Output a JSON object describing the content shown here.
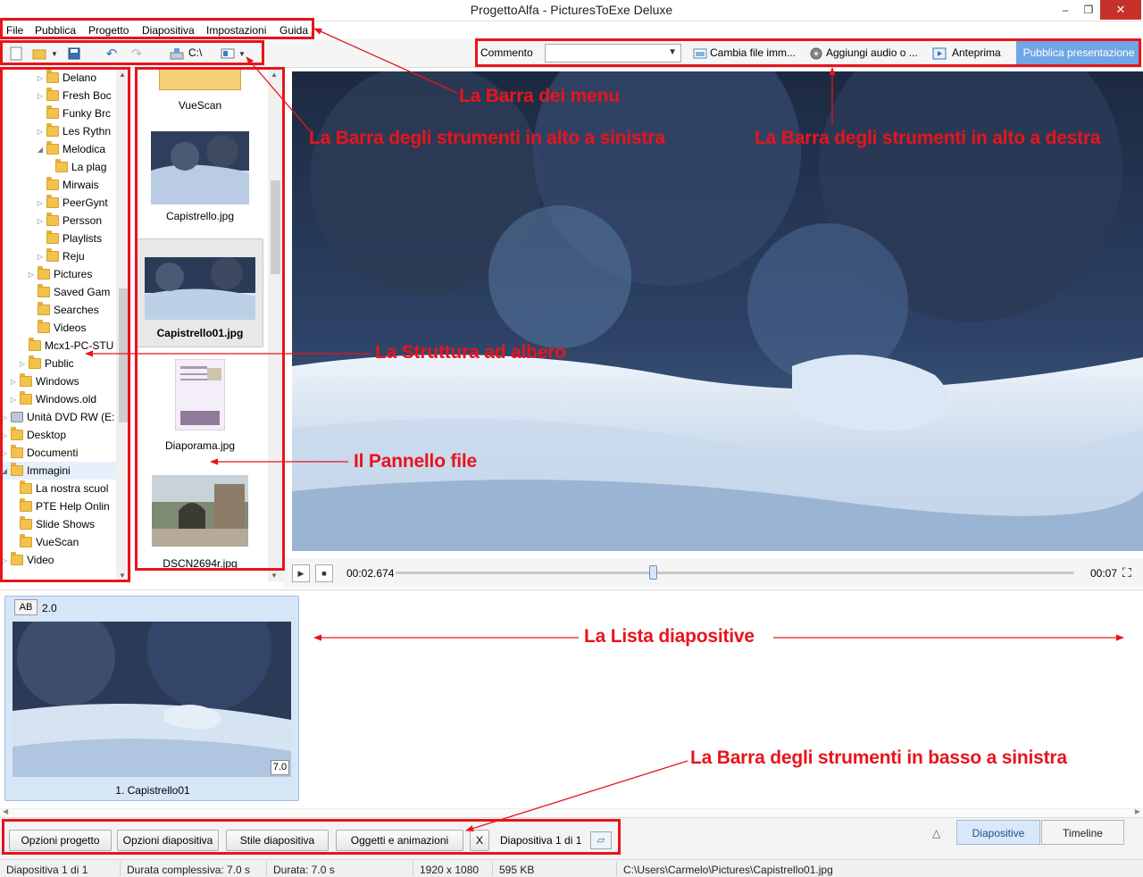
{
  "window": {
    "title": "ProgettoAlfa - PicturesToExe Deluxe",
    "minimize": "–",
    "maximize": "❐",
    "close": "✕"
  },
  "menu": [
    "File",
    "Pubblica",
    "Progetto",
    "Diapositiva",
    "Impostazioni",
    "Guida"
  ],
  "toolbar_left": {
    "drive_label": "C:\\"
  },
  "toolbar_right": {
    "comment_label": "Commento",
    "change_image": "Cambia file imm...",
    "add_audio": "Aggiungi audio o ...",
    "preview": "Anteprima",
    "publish": "Pubblica presentazione"
  },
  "tree": {
    "items": [
      {
        "label": "Delano",
        "icon": "folder"
      },
      {
        "label": "Fresh Boc",
        "icon": "folder"
      },
      {
        "label": "Funky Brc",
        "icon": "folder"
      },
      {
        "label": "Les Rythn",
        "icon": "folder"
      },
      {
        "label": "Melodica",
        "icon": "folder"
      },
      {
        "label": "La plag",
        "icon": "folder"
      },
      {
        "label": "Mirwais",
        "icon": "folder"
      },
      {
        "label": "PeerGynt",
        "icon": "folder"
      },
      {
        "label": "Persson",
        "icon": "folder"
      },
      {
        "label": "Playlists",
        "icon": "folder"
      },
      {
        "label": "Reju",
        "icon": "folder"
      },
      {
        "label": "Pictures",
        "icon": "folder"
      },
      {
        "label": "Saved Gam",
        "icon": "folder"
      },
      {
        "label": "Searches",
        "icon": "folder"
      },
      {
        "label": "Videos",
        "icon": "folder"
      },
      {
        "label": "Mcx1-PC-STU",
        "icon": "folder"
      },
      {
        "label": "Public",
        "icon": "folder"
      },
      {
        "label": "Windows",
        "icon": "folder"
      },
      {
        "label": "Windows.old",
        "icon": "folder"
      },
      {
        "label": "Unità DVD RW (E:",
        "icon": "drive"
      },
      {
        "label": "Desktop",
        "icon": "folder"
      },
      {
        "label": "Documenti",
        "icon": "folder"
      },
      {
        "label": "Immagini",
        "icon": "folder"
      },
      {
        "label": "La nostra scuol",
        "icon": "folder"
      },
      {
        "label": "PTE Help Onlin",
        "icon": "folder"
      },
      {
        "label": "Slide Shows",
        "icon": "folder"
      },
      {
        "label": "VueScan",
        "icon": "folder"
      },
      {
        "label": "Video",
        "icon": "folder"
      }
    ]
  },
  "files": {
    "items": [
      {
        "label": "VueScan"
      },
      {
        "label": "Capistrello.jpg"
      },
      {
        "label": "Capistrello01.jpg"
      },
      {
        "label": "Diaporama.jpg"
      },
      {
        "label": "DSCN2694r.jpg"
      }
    ]
  },
  "player": {
    "current_time": "00:02.674",
    "total_time": "00:07",
    "progress": 0.38
  },
  "slides": [
    {
      "transition_label": "AB",
      "transition_duration": "2.0",
      "duration": "7.0",
      "caption": "1. Capistrello01"
    }
  ],
  "bottom_toolbar": {
    "project_options": "Opzioni progetto",
    "slide_options": "Opzioni diapositiva",
    "slide_style": "Stile diapositiva",
    "objects_animations": "Oggetti e animazioni",
    "close_x": "X",
    "slide_counter": "Diapositiva 1 di 1",
    "collapse": "△",
    "tab_slides": "Diapositive",
    "tab_timeline": "Timeline"
  },
  "status": {
    "slide": "Diapositiva 1 di 1",
    "total_duration": "Durata complessiva: 7.0 s",
    "duration": "Durata: 7.0 s",
    "resolution": "1920 x 1080",
    "size": "595 KB",
    "path": "C:\\Users\\Carmelo\\Pictures\\Capistrello01.jpg"
  },
  "annotations": {
    "menu_bar": "La Barra dei menu",
    "toolbar_left": "La Barra degli strumenti in alto a sinistra",
    "toolbar_right": "La Barra degli strumenti in alto a destra",
    "tree": "La Struttura ad albero",
    "file_panel": "Il Pannello file",
    "slide_list": "La Lista diapositive",
    "bottom_toolbar": "La Barra degli strumenti in basso a sinistra",
    "color": "#e8141c"
  }
}
